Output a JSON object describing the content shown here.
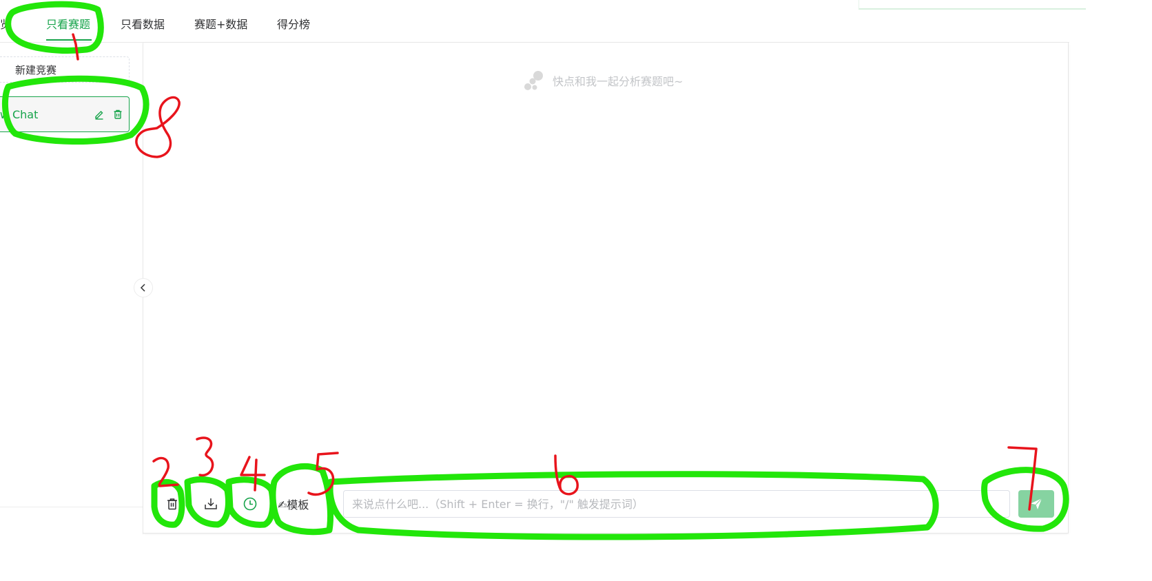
{
  "tabs": [
    {
      "label": "预览",
      "active": false
    },
    {
      "label": "只看赛题",
      "active": true
    },
    {
      "label": "只看数据",
      "active": false
    },
    {
      "label": "赛题+数据",
      "active": false
    },
    {
      "label": "得分榜",
      "active": false
    }
  ],
  "sidebar": {
    "new_competition_label": "新建竞赛",
    "chat_item_label": "New Chat",
    "chat_item_icons": [
      "edit-icon",
      "trash-icon"
    ]
  },
  "main": {
    "empty_hint": "快点和我一起分析赛题吧~"
  },
  "toolbar": {
    "clear_icon": "trash-icon",
    "download_icon": "download-icon",
    "history_icon": "clock-icon",
    "template_label": "✍模板",
    "input_placeholder": "来说点什么吧...（Shift + Enter = 换行，\"/\" 触发提示词）",
    "send_icon": "send-icon"
  },
  "annotations": {
    "labels": [
      "1",
      "2",
      "3",
      "4",
      "5",
      "6",
      "7",
      "8"
    ],
    "highlight_color": "#22e60a",
    "number_color": "#e8141c"
  },
  "colors": {
    "accent": "#16a34a",
    "send_button": "#86d3a1"
  }
}
